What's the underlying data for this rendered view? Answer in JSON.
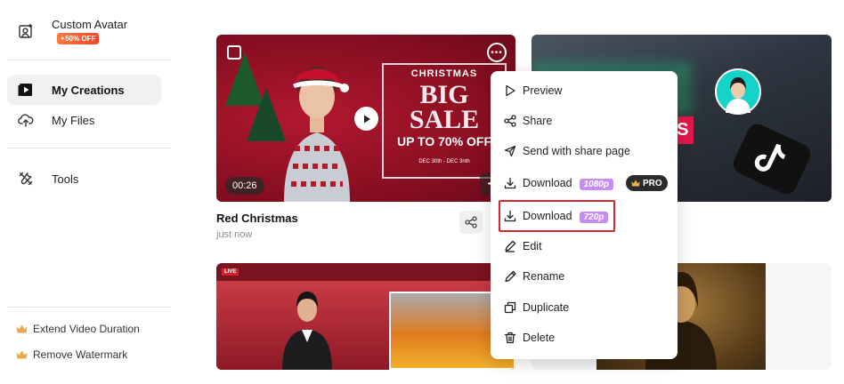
{
  "sidebar": {
    "top_item": {
      "label": "Custom Avatar",
      "badge": "50% OFF",
      "icon": "avatar-frame-icon"
    },
    "nav": [
      {
        "label": "My Creations",
        "icon": "play-square-icon",
        "active": true
      },
      {
        "label": "My Files",
        "icon": "cloud-upload-icon",
        "active": false
      }
    ],
    "tools": {
      "label": "Tools",
      "icon": "tools-icon"
    },
    "upgrades": [
      {
        "label": "Extend Video Duration",
        "icon": "crown-icon"
      },
      {
        "label": "Remove Watermark",
        "icon": "crown-icon"
      }
    ]
  },
  "cards": [
    {
      "title": "Red Christmas",
      "subtitle": "just now",
      "duration": "00:26",
      "overlay": {
        "heading": "CHRISTMAS",
        "big": "BIG",
        "sale": "SALE",
        "discount": "UP TO 70% OFF",
        "dates": "DEC 30th - DEC 3nth"
      }
    },
    {
      "overlay_text": "TIPS",
      "brand": "TikTok"
    },
    {
      "live_tag": "LIVE"
    },
    {}
  ],
  "context_menu": {
    "items": [
      {
        "label": "Preview",
        "icon": "play-outline-icon"
      },
      {
        "label": "Share",
        "icon": "share-nodes-icon"
      },
      {
        "label": "Send with share page",
        "icon": "send-icon"
      },
      {
        "label": "Download",
        "badge": "1080p",
        "pro": "PRO",
        "icon": "download-icon"
      },
      {
        "label": "Download",
        "badge": "720p",
        "icon": "download-icon",
        "highlighted": true
      },
      {
        "label": "Edit",
        "icon": "edit-icon"
      },
      {
        "label": "Rename",
        "icon": "pen-icon"
      },
      {
        "label": "Duplicate",
        "icon": "duplicate-icon"
      },
      {
        "label": "Delete",
        "icon": "trash-icon"
      }
    ]
  },
  "colors": {
    "active_bg": "#f1f1f2",
    "badge_purple": "#c58cf4",
    "highlight_red": "#d9262e",
    "crown_gold": "#e7a84a"
  }
}
